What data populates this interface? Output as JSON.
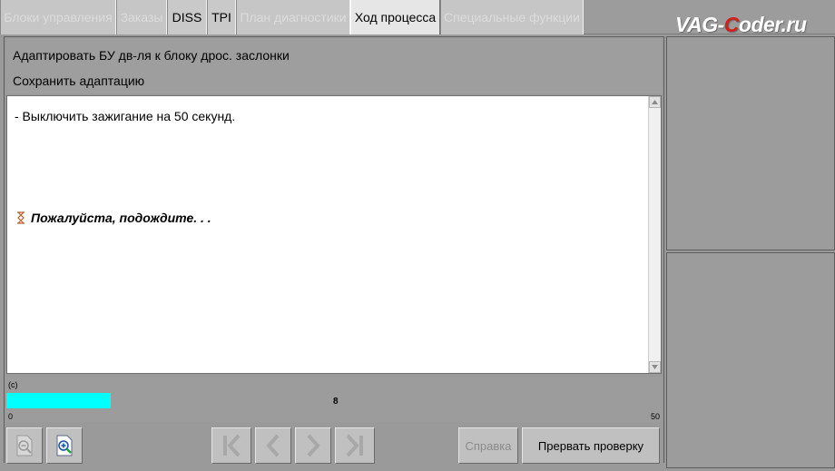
{
  "tabs": [
    {
      "label": "Блоки управления",
      "enabled": false
    },
    {
      "label": "Заказы",
      "enabled": false
    },
    {
      "label": "DISS",
      "enabled": true
    },
    {
      "label": "TPI",
      "enabled": true
    },
    {
      "label": "План диагностики",
      "enabled": false
    },
    {
      "label": "Ход процесса",
      "enabled": true,
      "active": true
    },
    {
      "label": "Специальные функции",
      "enabled": false
    }
  ],
  "watermark": {
    "prefix": "VAG-",
    "accent": "C",
    "suffix": "oder.ru",
    "accent_color": "#d0201a"
  },
  "header": {
    "line1": "Адаптировать БУ дв-ля к блоку дрос. заслонки",
    "line2": "Сохранить адаптацию"
  },
  "content": {
    "instruction": "- Выключить зажигание на 50 секунд.",
    "wait_text": "Пожалуйста, подождите. . ."
  },
  "progress": {
    "unit": "(c)",
    "value": "8",
    "min": "0",
    "max": "50",
    "fill_color": "#00ffff"
  },
  "toolbar": {
    "help_label": "Справка",
    "abort_label": "Прервать проверку"
  },
  "icons": {
    "zoom_out": "zoom-out-icon",
    "zoom_in": "zoom-in-icon",
    "first": "skip-first-icon",
    "prev": "prev-icon",
    "next": "next-icon",
    "last": "skip-last-icon",
    "hourglass": "hourglass-icon"
  }
}
